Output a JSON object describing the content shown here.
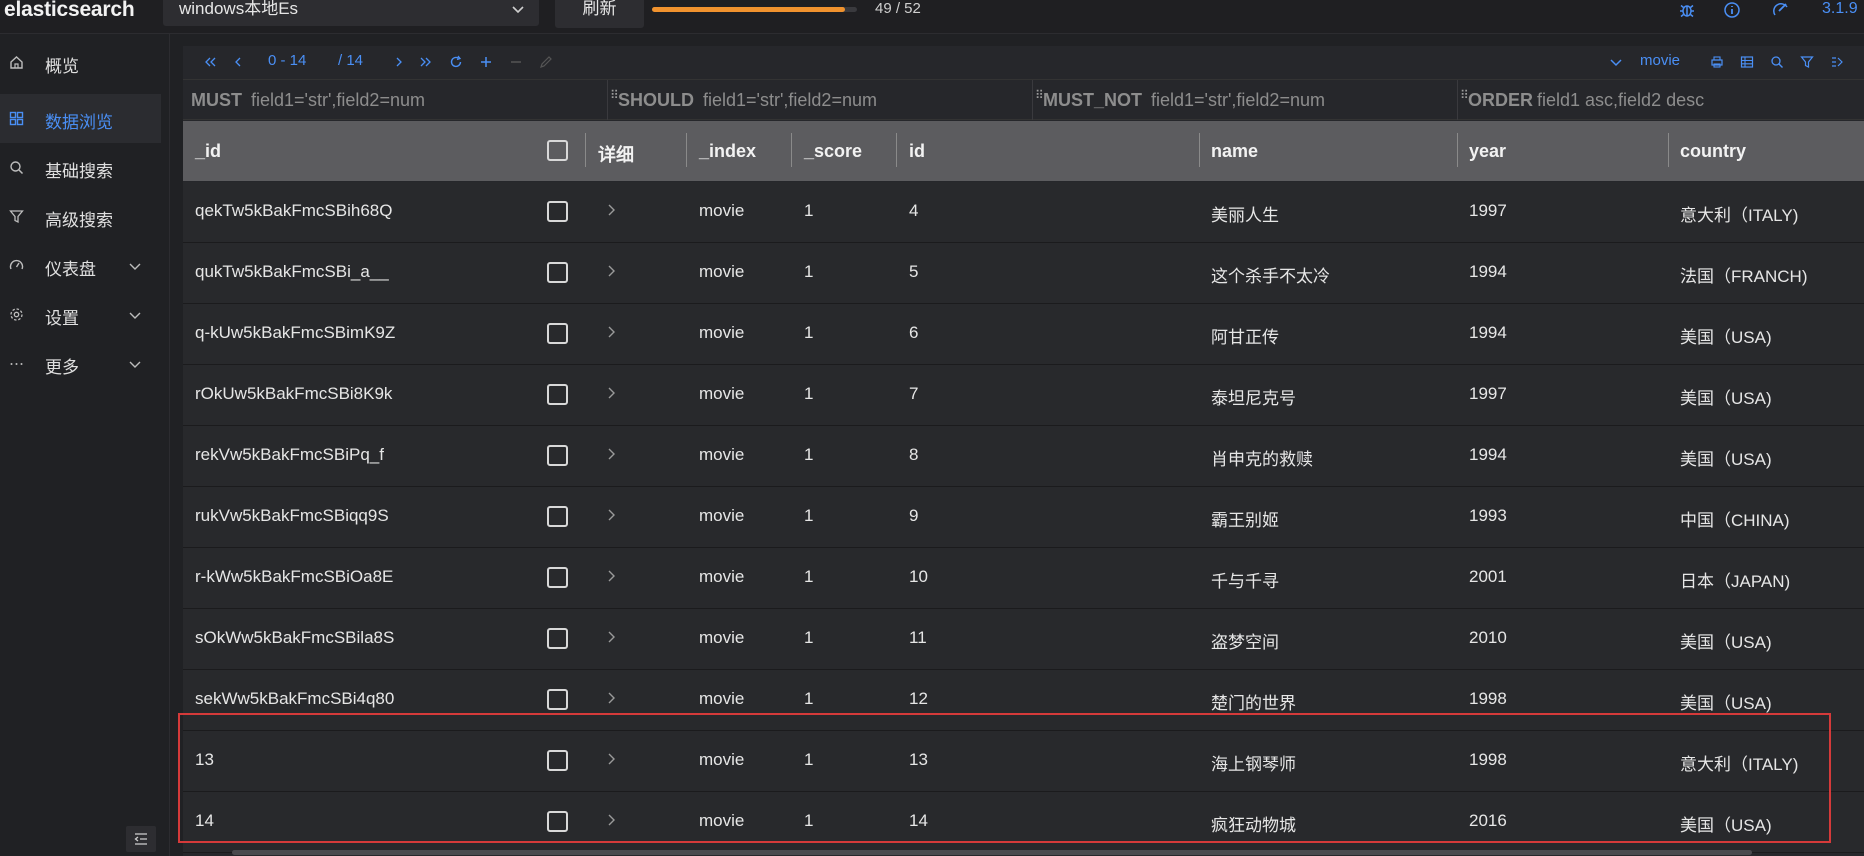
{
  "app": {
    "logo": "elasticsearch",
    "connection": "windows本地Es",
    "refresh_label": "刷新",
    "progress_text": "49 / 52",
    "progress_fraction": 0.94,
    "version": "3.1.9"
  },
  "sidebar": {
    "items": [
      {
        "label": "概览",
        "icon": "home-icon"
      },
      {
        "label": "数据浏览",
        "icon": "grid-icon",
        "active": true
      },
      {
        "label": "基础搜索",
        "icon": "search-icon"
      },
      {
        "label": "高级搜索",
        "icon": "filter-icon"
      },
      {
        "label": "仪表盘",
        "icon": "dashboard-icon",
        "expandable": true
      },
      {
        "label": "设置",
        "icon": "gear-icon",
        "expandable": true
      },
      {
        "label": "更多",
        "icon": "more-icon",
        "expandable": true
      }
    ]
  },
  "toolbar": {
    "range": "0 - 14",
    "total": "/ 14",
    "index_name": "movie"
  },
  "filters": {
    "must": {
      "key": "MUST",
      "hint": "field1='str',field2=num"
    },
    "should": {
      "key": "SHOULD",
      "hint": "field1='str',field2=num"
    },
    "must_not": {
      "key": "MUST_NOT",
      "hint": "field1='str',field2=num"
    },
    "order": {
      "key": "ORDER",
      "hint": "field1 asc,field2 desc"
    }
  },
  "table": {
    "columns": {
      "_id": "_id",
      "detail": "详细",
      "_index": "_index",
      "_score": "_score",
      "id": "id",
      "name": "name",
      "year": "year",
      "country": "country"
    },
    "rows": [
      {
        "_id": "qekTw5kBakFmcSBih68Q",
        "_index": "movie",
        "_score": "1",
        "id": "4",
        "name": "美丽人生",
        "year": "1997",
        "country": "意大利（ITALY)"
      },
      {
        "_id": "qukTw5kBakFmcSBi_a__",
        "_index": "movie",
        "_score": "1",
        "id": "5",
        "name": "这个杀手不太冷",
        "year": "1994",
        "country": "法国（FRANCH)"
      },
      {
        "_id": "q-kUw5kBakFmcSBimK9Z",
        "_index": "movie",
        "_score": "1",
        "id": "6",
        "name": "阿甘正传",
        "year": "1994",
        "country": "美国（USA)"
      },
      {
        "_id": "rOkUw5kBakFmcSBi8K9k",
        "_index": "movie",
        "_score": "1",
        "id": "7",
        "name": "泰坦尼克号",
        "year": "1997",
        "country": "美国（USA)"
      },
      {
        "_id": "rekVw5kBakFmcSBiPq_f",
        "_index": "movie",
        "_score": "1",
        "id": "8",
        "name": "肖申克的救赎",
        "year": "1994",
        "country": "美国（USA)"
      },
      {
        "_id": "rukVw5kBakFmcSBiqq9S",
        "_index": "movie",
        "_score": "1",
        "id": "9",
        "name": "霸王别姬",
        "year": "1993",
        "country": "中国（CHINA)"
      },
      {
        "_id": "r-kWw5kBakFmcSBiOa8E",
        "_index": "movie",
        "_score": "1",
        "id": "10",
        "name": "千与千寻",
        "year": "2001",
        "country": "日本（JAPAN)"
      },
      {
        "_id": "sOkWw5kBakFmcSBila8S",
        "_index": "movie",
        "_score": "1",
        "id": "11",
        "name": "盗梦空间",
        "year": "2010",
        "country": "美国（USA)"
      },
      {
        "_id": "sekWw5kBakFmcSBi4q80",
        "_index": "movie",
        "_score": "1",
        "id": "12",
        "name": "楚门的世界",
        "year": "1998",
        "country": "美国（USA)"
      },
      {
        "_id": "13",
        "_index": "movie",
        "_score": "1",
        "id": "13",
        "name": "海上钢琴师",
        "year": "1998",
        "country": "意大利（ITALY)"
      },
      {
        "_id": "14",
        "_index": "movie",
        "_score": "1",
        "id": "14",
        "name": "疯狂动物城",
        "year": "2016",
        "country": "美国（USA)"
      }
    ]
  },
  "colors": {
    "accent": "#4a8ff5",
    "progress": "#f0922e",
    "highlight": "#d53a3a"
  }
}
